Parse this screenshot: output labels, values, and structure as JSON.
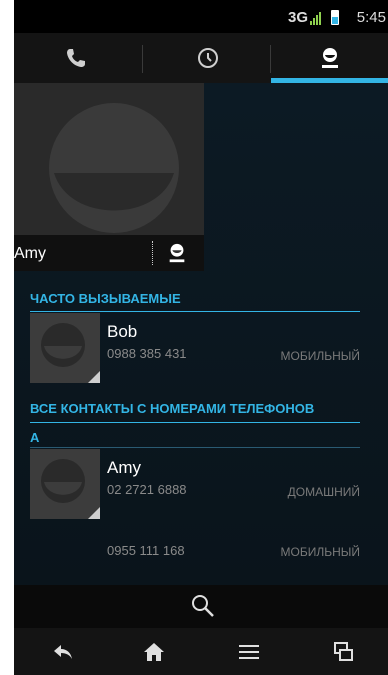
{
  "status_bar": {
    "network": "3G",
    "time": "5:45"
  },
  "tabs": [
    {
      "icon": "phone-icon",
      "active": false
    },
    {
      "icon": "clock-icon",
      "active": false
    },
    {
      "icon": "contact-icon",
      "active": true
    }
  ],
  "favorite": {
    "name": "Amy"
  },
  "sections": {
    "frequent": "ЧАСТО ВЫЗЫВАЕМЫЕ",
    "all_contacts": "ВСЕ КОНТАКТЫ С НОМЕРАМИ ТЕЛЕФОНОВ"
  },
  "frequent_contacts": [
    {
      "name": "Bob",
      "phone": "0988 385 431",
      "type": "МОБИЛЬНЫЙ"
    }
  ],
  "letter_index": "А",
  "contacts": [
    {
      "name": "Amy",
      "phone": "02 2721 6888",
      "type": "ДОМАШНИЙ"
    },
    {
      "name": "",
      "phone": "0955 111 168",
      "type": "МОБИЛЬНЫЙ"
    }
  ],
  "colors": {
    "accent": "#33b5e5",
    "background": "#000000"
  },
  "bottom_nav": [
    "back-icon",
    "home-icon",
    "menu-icon",
    "recent-apps-icon"
  ]
}
